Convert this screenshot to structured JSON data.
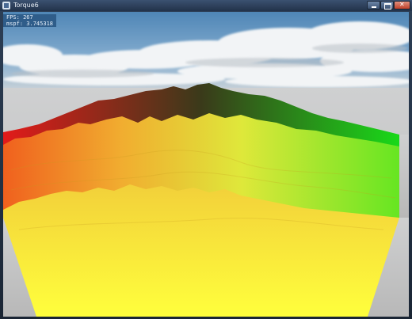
{
  "window": {
    "title": "Torque6",
    "icon": "app-icon",
    "controls": [
      "minimize-icon",
      "maximize-icon",
      "close-icon"
    ]
  },
  "hud": {
    "fps": "FPS: 267",
    "mspf": "mspf: 3.745318"
  },
  "scene": {
    "sky_color": "#6b9bc4",
    "horizon_color": "#c9d2d8",
    "ground_color": "#c4c4c4",
    "terrain_gradient": [
      "#e81e1e",
      "#f0a020",
      "#ffff40",
      "#20e020"
    ]
  }
}
